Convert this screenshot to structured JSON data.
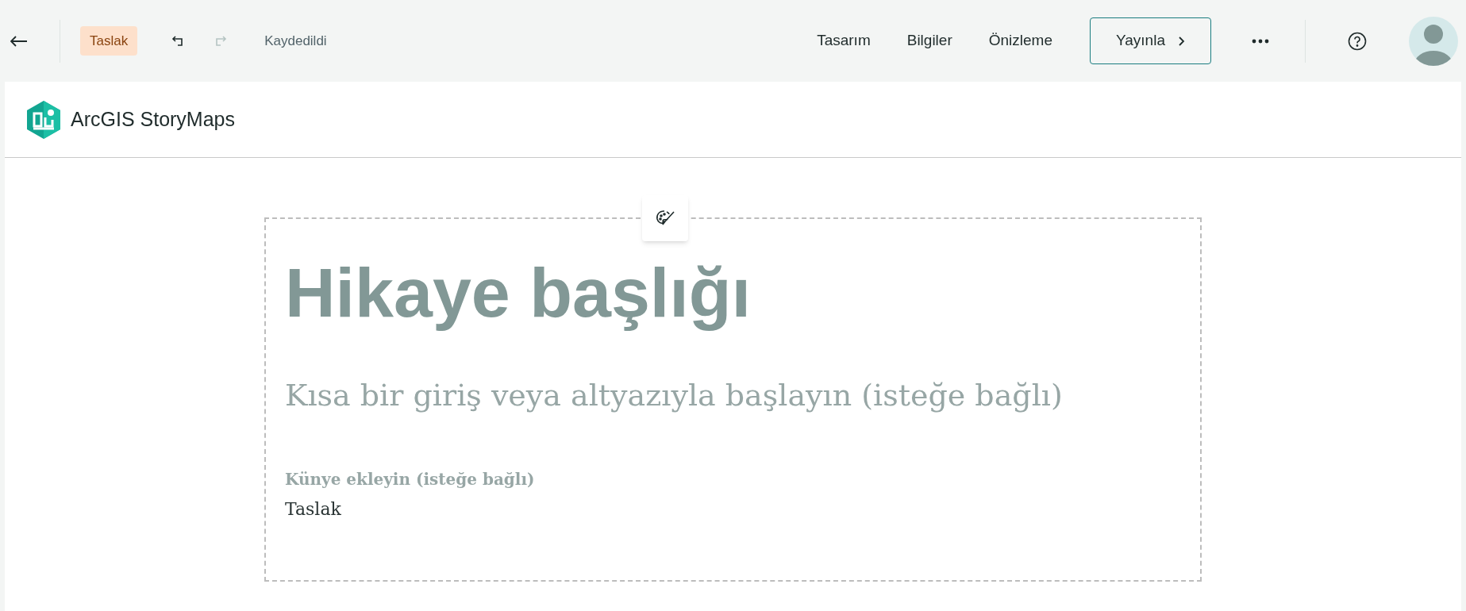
{
  "toolbar": {
    "status_badge": "Taslak",
    "undo": {
      "disabled": false
    },
    "redo": {
      "disabled": true
    },
    "save_status": "Kaydedildi",
    "nav": [
      "Tasarım",
      "Bilgiler",
      "Önizleme"
    ],
    "publish_button": "Yayınla"
  },
  "brand": {
    "name": "ArcGIS StoryMaps"
  },
  "story": {
    "title": "Hikaye başlığı",
    "subtitle": "Kısa bir giriş veya altyazıyla başlayın (isteğe bağlı)",
    "byline_placeholder": "Künye ekleyin (isteğe bağlı)",
    "byline": "Taslak"
  }
}
